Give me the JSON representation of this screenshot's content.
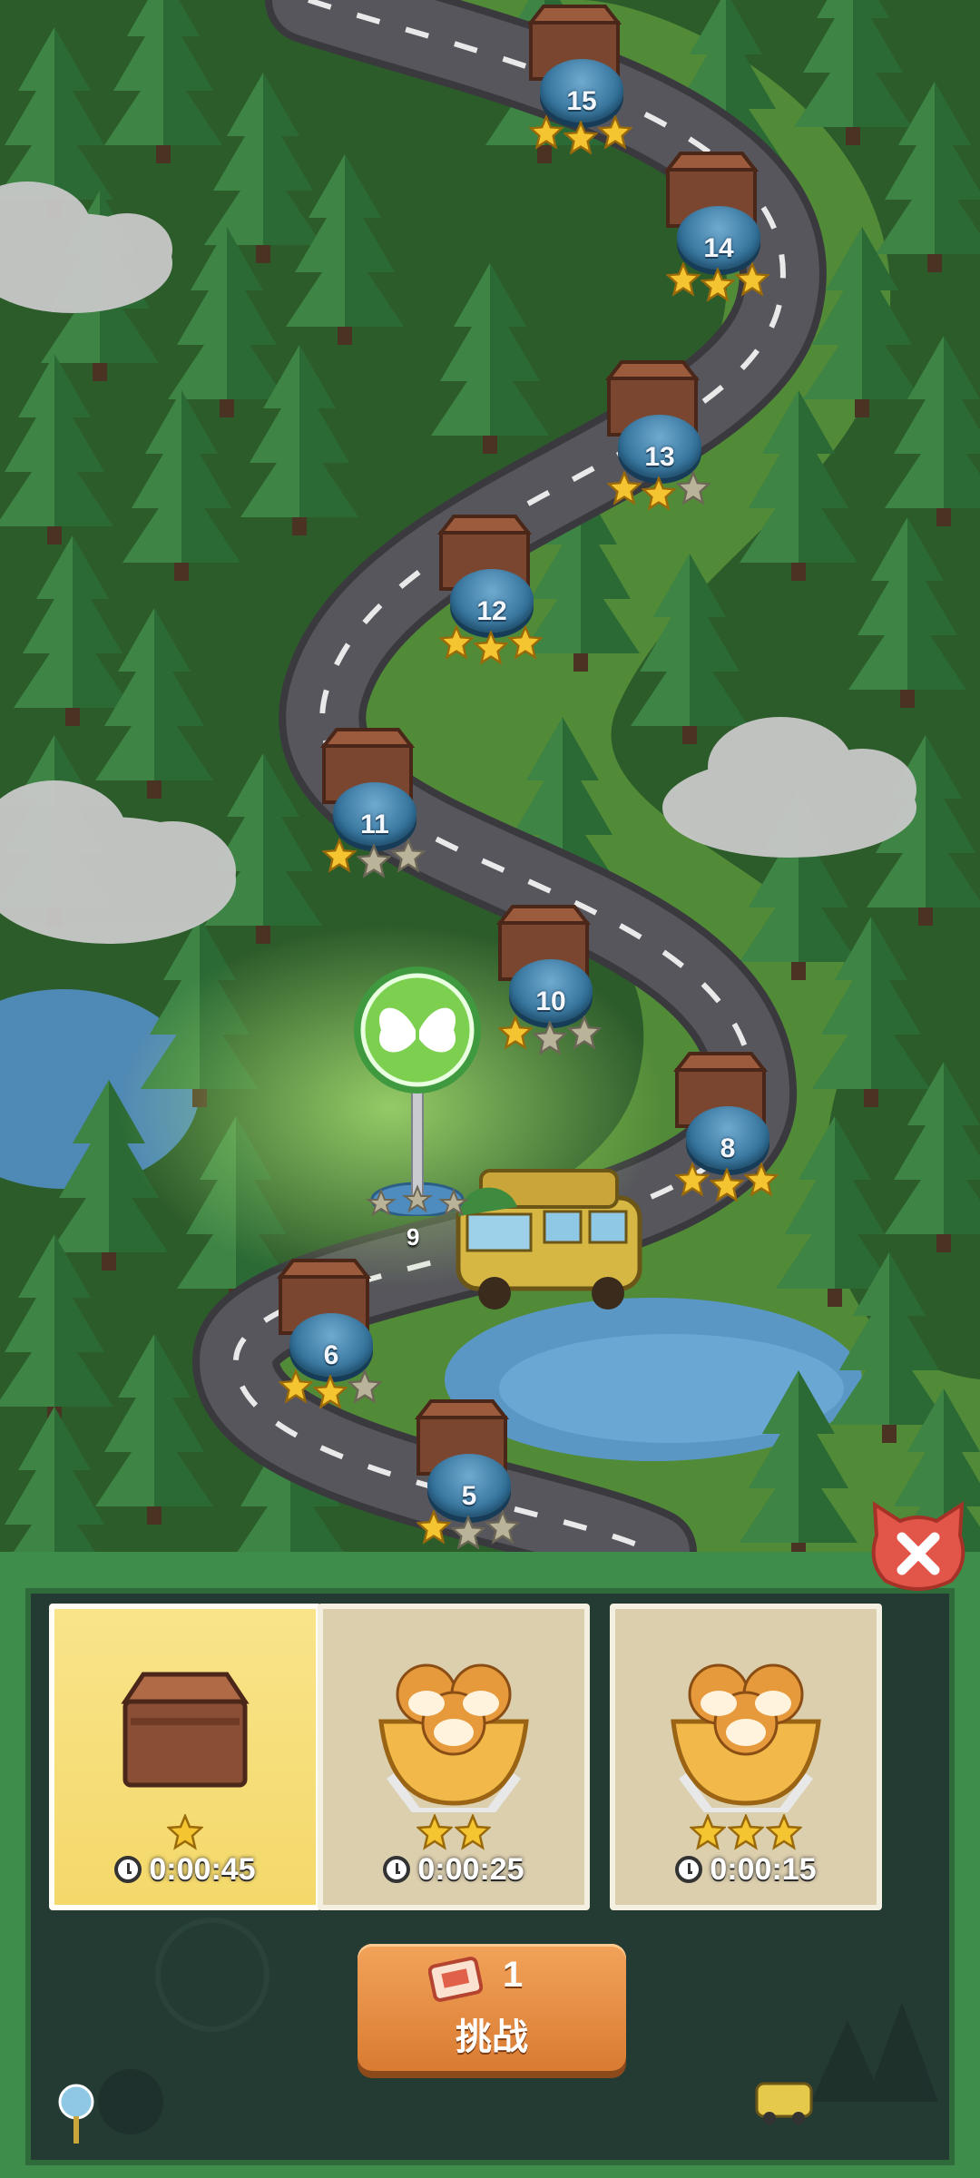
{
  "map": {
    "levels": [
      {
        "number": "15",
        "stars": 3
      },
      {
        "number": "14",
        "stars": 3
      },
      {
        "number": "13",
        "stars": 2
      },
      {
        "number": "12",
        "stars": 3
      },
      {
        "number": "11",
        "stars": 1
      },
      {
        "number": "10",
        "stars": 1
      },
      {
        "number": "8",
        "stars": 3
      },
      {
        "number": "6",
        "stars": 2
      },
      {
        "number": "5",
        "stars": 1
      }
    ],
    "current_level": {
      "number": "9",
      "stars": 0,
      "icon": "butterfly-icon"
    }
  },
  "difficulty_options": [
    {
      "stars": 1,
      "time": "0:00:45",
      "reward_icon": "crate-icon",
      "selected": true
    },
    {
      "stars": 2,
      "time": "0:00:25",
      "reward_icon": "shiba-bag-icon",
      "selected": false
    },
    {
      "stars": 3,
      "time": "0:00:15",
      "reward_icon": "shiba-bag-icon",
      "selected": false
    }
  ],
  "challenge_button": {
    "count": "1",
    "label": "挑战",
    "icon": "ticket-icon"
  },
  "close_button": {
    "icon": "close-icon"
  },
  "colors": {
    "star_gold": "#f5c531",
    "star_empty": "#b9b39a",
    "button_orange": "#e58b3d",
    "board": "#243b33"
  }
}
